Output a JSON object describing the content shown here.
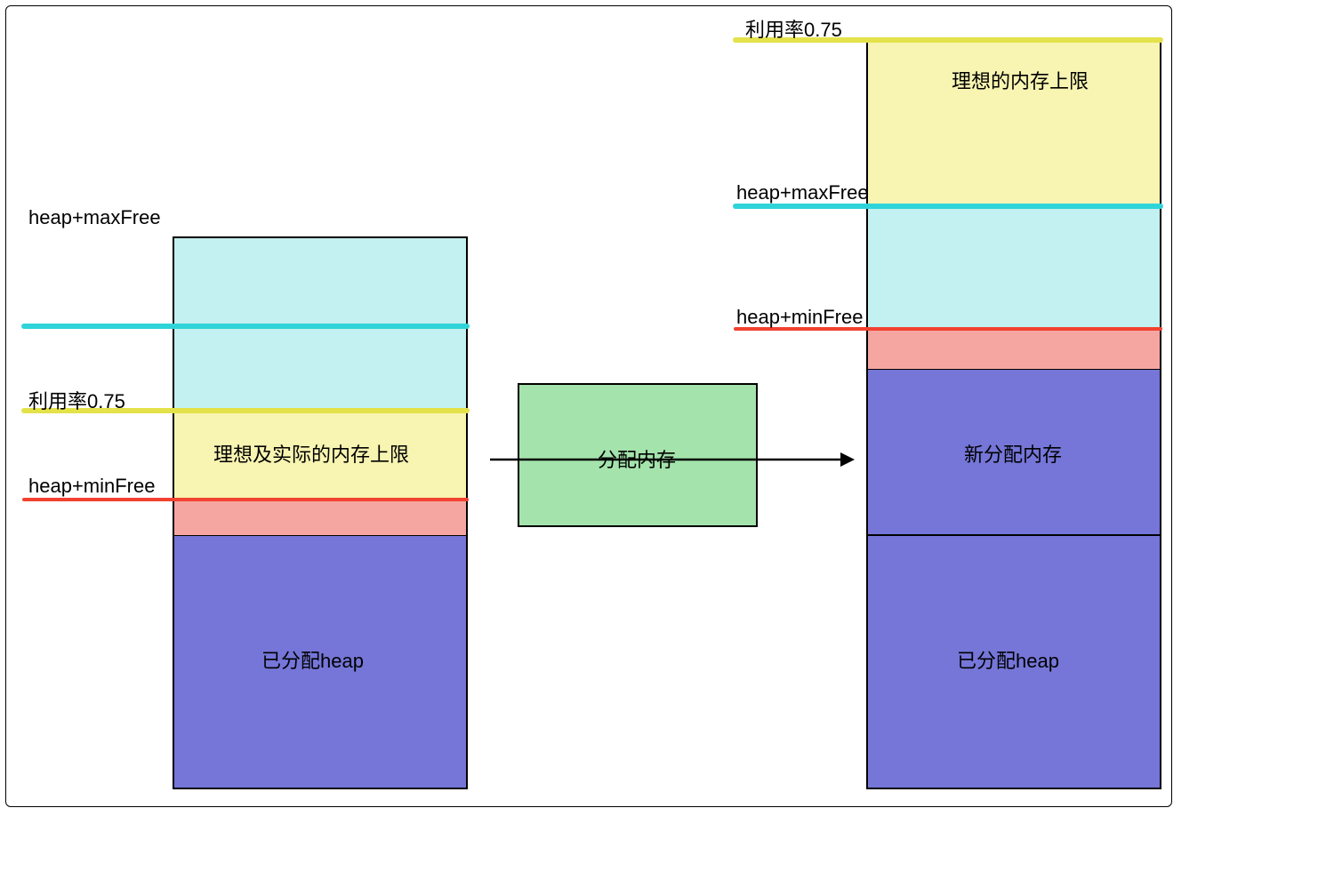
{
  "labels": {
    "utilization": "利用率0.75",
    "heap_max_free": "heap+maxFree",
    "heap_min_free": "heap+minFree",
    "ideal_actual_limit": "理想及实际的内存上限",
    "ideal_limit": "理想的内存上限",
    "allocated_heap": "已分配heap",
    "allocate_mem": "分配内存",
    "new_allocated": "新分配内存"
  },
  "colors": {
    "cyan_fill": "#c3f0f0",
    "cyan_line": "#2fd4d9",
    "yellow_fill": "#f8f4b1",
    "yellow_line": "#e4e24a",
    "red_fill": "#f6a6a1",
    "red_line": "#f24130",
    "blue_fill": "#7576d8",
    "green_fill": "#a4e3ac",
    "axis": "#000000"
  },
  "chart_data": {
    "type": "diagram",
    "description": "Heap memory allocation before and after allocating more memory, showing thresholds",
    "utilization_ratio": 0.75,
    "left_stack": {
      "segments_top_to_bottom": [
        {
          "name": "cyan_above_maxFree_indicator",
          "approx_height_ratio": 0.19
        },
        {
          "name": "utilization_ideal_zone_yellow",
          "approx_height_ratio": 0.17
        },
        {
          "name": "minFree_red",
          "approx_height_ratio": 0.06
        },
        {
          "name": "allocated_heap_blue",
          "approx_height_ratio": 0.43
        }
      ],
      "threshold_lines": [
        "heap+maxFree",
        "利用率0.75",
        "heap+minFree"
      ]
    },
    "right_stack": {
      "segments_top_to_bottom": [
        {
          "name": "ideal_limit_yellow",
          "approx_height_ratio": 0.22
        },
        {
          "name": "cyan_zone",
          "approx_height_ratio": 0.16
        },
        {
          "name": "minFree_red",
          "approx_height_ratio": 0.05
        },
        {
          "name": "new_allocated_blue",
          "approx_height_ratio": 0.22
        },
        {
          "name": "allocated_heap_blue",
          "approx_height_ratio": 0.33
        }
      ],
      "threshold_lines": [
        "利用率0.75",
        "heap+maxFree",
        "heap+minFree"
      ]
    },
    "transition": "分配内存"
  }
}
